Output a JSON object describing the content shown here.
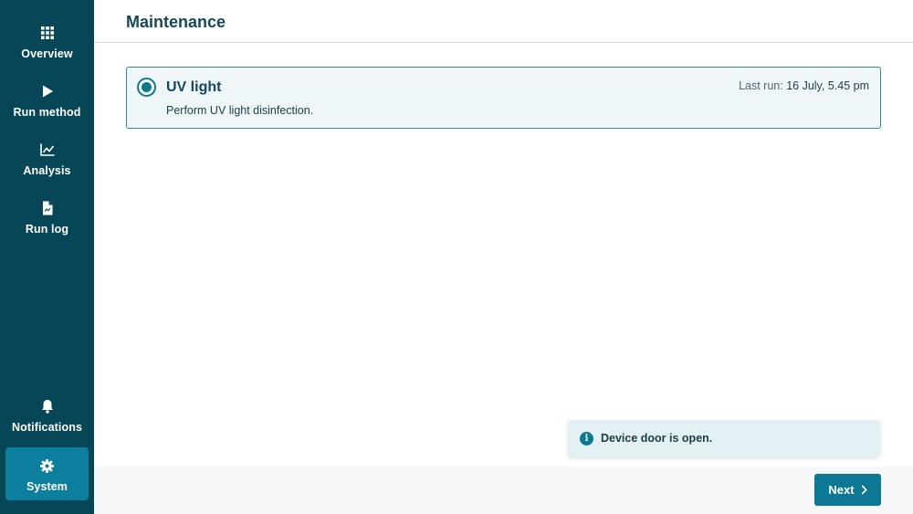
{
  "sidebar": {
    "items": [
      {
        "label": "Overview",
        "icon": "grid-icon"
      },
      {
        "label": "Run method",
        "icon": "play-icon"
      },
      {
        "label": "Analysis",
        "icon": "chart-line-icon"
      },
      {
        "label": "Run log",
        "icon": "file-icon"
      },
      {
        "label": "Notifications",
        "icon": "bell-icon"
      },
      {
        "label": "System",
        "icon": "gear-icon",
        "active": true
      }
    ]
  },
  "header": {
    "title": "Maintenance"
  },
  "card": {
    "title": "UV light",
    "description": "Perform UV light disinfection.",
    "last_run_label": "Last run:",
    "last_run_value": "16 July, 5.45 pm",
    "selected": true
  },
  "toast": {
    "icon": "info-icon",
    "icon_glyph": "i",
    "message": "Device door is open."
  },
  "footer": {
    "next_label": "Next",
    "next_icon": "chevron-right-icon"
  },
  "colors": {
    "sidebar": "#064656",
    "accent": "#0c7893",
    "active_nav": "#0c7f9e",
    "card_bg": "#eef6f8"
  }
}
